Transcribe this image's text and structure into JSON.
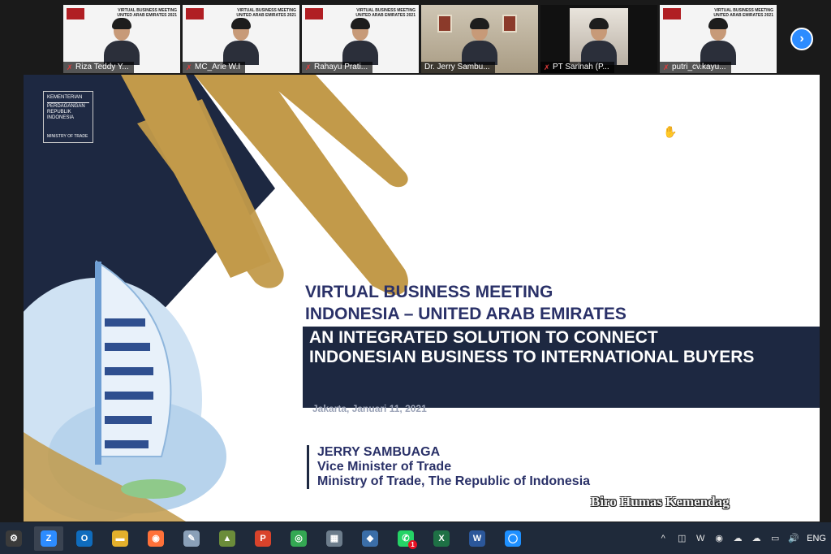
{
  "participants": [
    {
      "name": "Riza Teddy Y...",
      "muted": true,
      "background": "event-slide",
      "event_title": "VIRTUAL BUSINESS MEETING UNITED ARAB EMIRATES 2021"
    },
    {
      "name": "MC_Arie W.I",
      "muted": true,
      "background": "event-slide",
      "event_title": "VIRTUAL BUSINESS MEETING UNITED ARAB EMIRATES 2021"
    },
    {
      "name": "Rahayu Prati...",
      "muted": true,
      "background": "event-slide",
      "event_title": "VIRTUAL BUSINESS MEETING UNITED ARAB EMIRATES 2021"
    },
    {
      "name": "Dr. Jerry Sambu...",
      "muted": false,
      "background": "office",
      "active_speaker": true
    },
    {
      "name": "PT Sarinah (P...",
      "muted": true,
      "background": "home"
    },
    {
      "name": "putri_cv.kayu...",
      "muted": true,
      "background": "event-slide",
      "event_title": "VIRTUAL BUSINESS MEETING UNITED ARAB EMIRATES 2021"
    }
  ],
  "strip": {
    "next_icon": "chevron-right-icon",
    "next_glyph": "›"
  },
  "slide": {
    "logo": {
      "line1": "KEMENTERIAN",
      "line2": "PERDAGANGAN",
      "line3": "REPUBLIK INDONESIA",
      "footer": "MINISTRY OF TRADE"
    },
    "title_line1": "VIRTUAL BUSINESS MEETING",
    "title_line2": "INDONESIA – UNITED ARAB EMIRATES",
    "theme": "AN INTEGRATED SOLUTION TO CONNECT INDONESIAN BUSINESS TO INTERNATIONAL BUYERS",
    "date_line": "Jakarta, Januari 11, 2021",
    "speaker_name": "JERRY SAMBUAGA",
    "speaker_role": "Vice Minister of Trade",
    "speaker_org": "Ministry of Trade, The Republic of Indonesia",
    "colors": {
      "navy": "#1d2841",
      "gold": "#c29a4a",
      "title": "#2a3168"
    }
  },
  "watermark": "Biro Humas Kemendag",
  "taskbar": {
    "apps": [
      {
        "name": "start-icon",
        "glyph": "⚙",
        "color": "#3b3b3b"
      },
      {
        "name": "zoom-icon",
        "glyph": "Z",
        "color": "#2d8cff",
        "running": true
      },
      {
        "name": "outlook-icon",
        "glyph": "O",
        "color": "#0f6cbd"
      },
      {
        "name": "file-explorer-icon",
        "glyph": "▬",
        "color": "#e3b02c"
      },
      {
        "name": "firefox-icon",
        "glyph": "◉",
        "color": "#ff7139"
      },
      {
        "name": "paint-icon",
        "glyph": "✎",
        "color": "#8aa0b8"
      },
      {
        "name": "app-icon",
        "glyph": "▲",
        "color": "#6b8c3a"
      },
      {
        "name": "pdf-icon",
        "glyph": "P",
        "color": "#d9432b"
      },
      {
        "name": "chrome-icon",
        "glyph": "◎",
        "color": "#34a853"
      },
      {
        "name": "calculator-icon",
        "glyph": "▦",
        "color": "#6d7d8c"
      },
      {
        "name": "network-app-icon",
        "glyph": "◆",
        "color": "#3b6ea8"
      },
      {
        "name": "whatsapp-icon",
        "glyph": "✆",
        "color": "#25d366",
        "badge": "1"
      },
      {
        "name": "excel-icon",
        "glyph": "X",
        "color": "#1e7145"
      },
      {
        "name": "word-icon",
        "glyph": "W",
        "color": "#2b579a"
      },
      {
        "name": "browser-icon",
        "glyph": "◯",
        "color": "#1e90ff"
      }
    ],
    "tray": {
      "chevron": "^",
      "language": "ENG"
    }
  }
}
